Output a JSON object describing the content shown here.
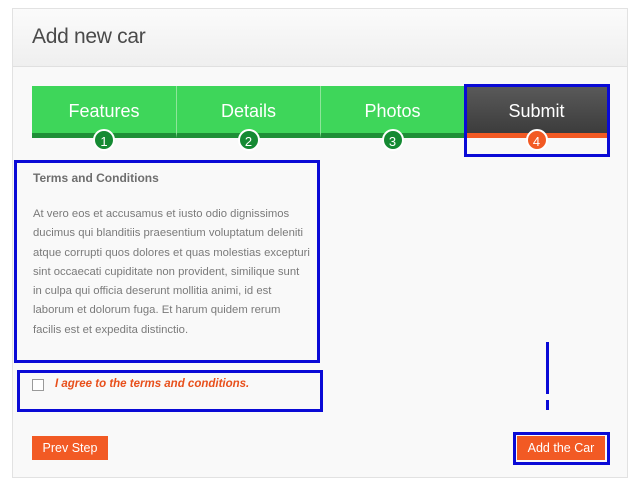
{
  "panel": {
    "title": "Add new car"
  },
  "steps": [
    {
      "label": "Features",
      "number": "1",
      "active": false
    },
    {
      "label": "Details",
      "number": "2",
      "active": false
    },
    {
      "label": "Photos",
      "number": "3",
      "active": false
    },
    {
      "label": "Submit",
      "number": "4",
      "active": true
    }
  ],
  "terms": {
    "title": "Terms and Conditions",
    "body": "At vero eos et accusamus et iusto odio dignissimos ducimus qui blanditiis praesentium voluptatum deleniti atque corrupti quos dolores et quas molestias excepturi sint occaecati cupiditate non provident, similique sunt in culpa qui officia deserunt mollitia animi, id est laborum et dolorum fuga. Et harum quidem rerum facilis est et expedita distinctio."
  },
  "agreement": {
    "label": "I agree to the terms and conditions.",
    "checked": false
  },
  "actions": {
    "prev_label": "Prev Step",
    "submit_label": "Add the Car"
  },
  "colors": {
    "step_green": "#3ed65a",
    "step_dark_green": "#1e8f37",
    "active_dark": "#3c3c3c",
    "accent_orange": "#f25a24",
    "highlight_blue": "#0a0ad6"
  }
}
